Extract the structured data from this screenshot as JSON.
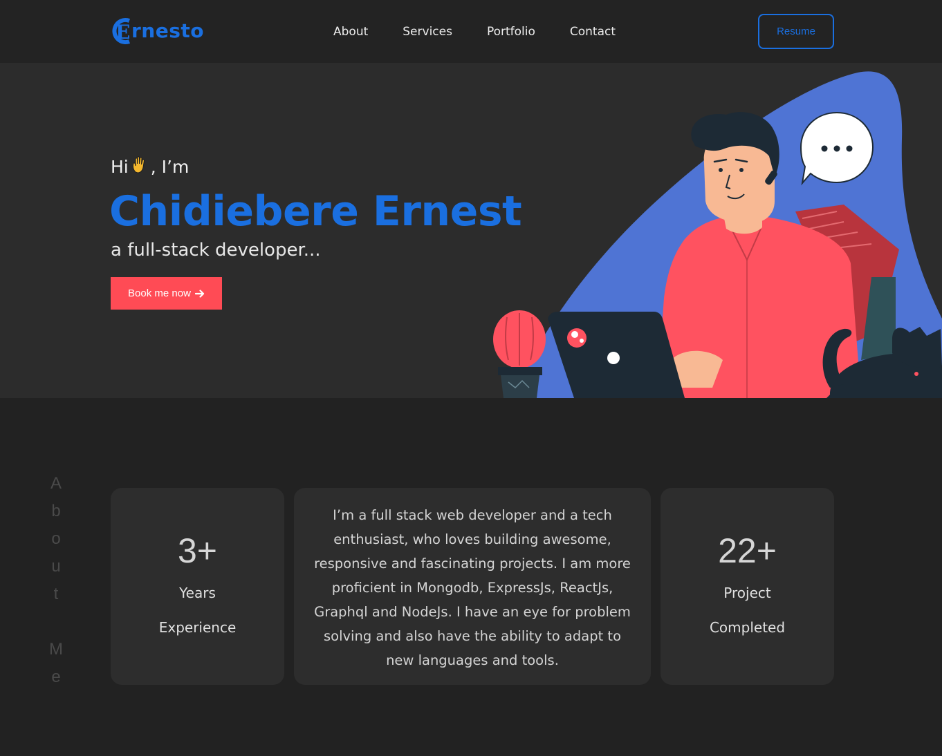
{
  "header": {
    "logo_text": "rnesto",
    "logo_initial": "E",
    "nav": [
      "About",
      "Services",
      "Portfolio",
      "Contact"
    ],
    "resume_label": "Resume"
  },
  "hero": {
    "greeting_prefix": "Hi",
    "greeting_suffix": ", I’m",
    "wave_icon": "waving-hand-icon",
    "name": "Chidiebere Ernest",
    "role": "a full-stack developer...",
    "cta_label": "Book me now",
    "cta_icon": "arrow-right-icon"
  },
  "about": {
    "vertical_label": [
      "A",
      "b",
      "o",
      "u",
      "t",
      "",
      "M",
      "e"
    ],
    "stats_left": {
      "value": "3+",
      "line1": "Years",
      "line2": "Experience"
    },
    "bio": "I’m a full stack web developer and a tech enthusiast, who loves building awesome, responsive and fascinating projects. I am more proficient in Mongodb, ExpressJs, ReactJs, Graphql and NodeJs. I have an eye for problem solving and also have the ability to adapt to new languages and tools.",
    "stats_right": {
      "value": "22+",
      "line1": "Project",
      "line2": "Completed"
    }
  },
  "colors": {
    "accent": "#1a6fe0",
    "cta": "#ff4b55",
    "background": "#222222",
    "hero_bg": "#2c2c2c",
    "card_bg": "#2d2d2d"
  }
}
